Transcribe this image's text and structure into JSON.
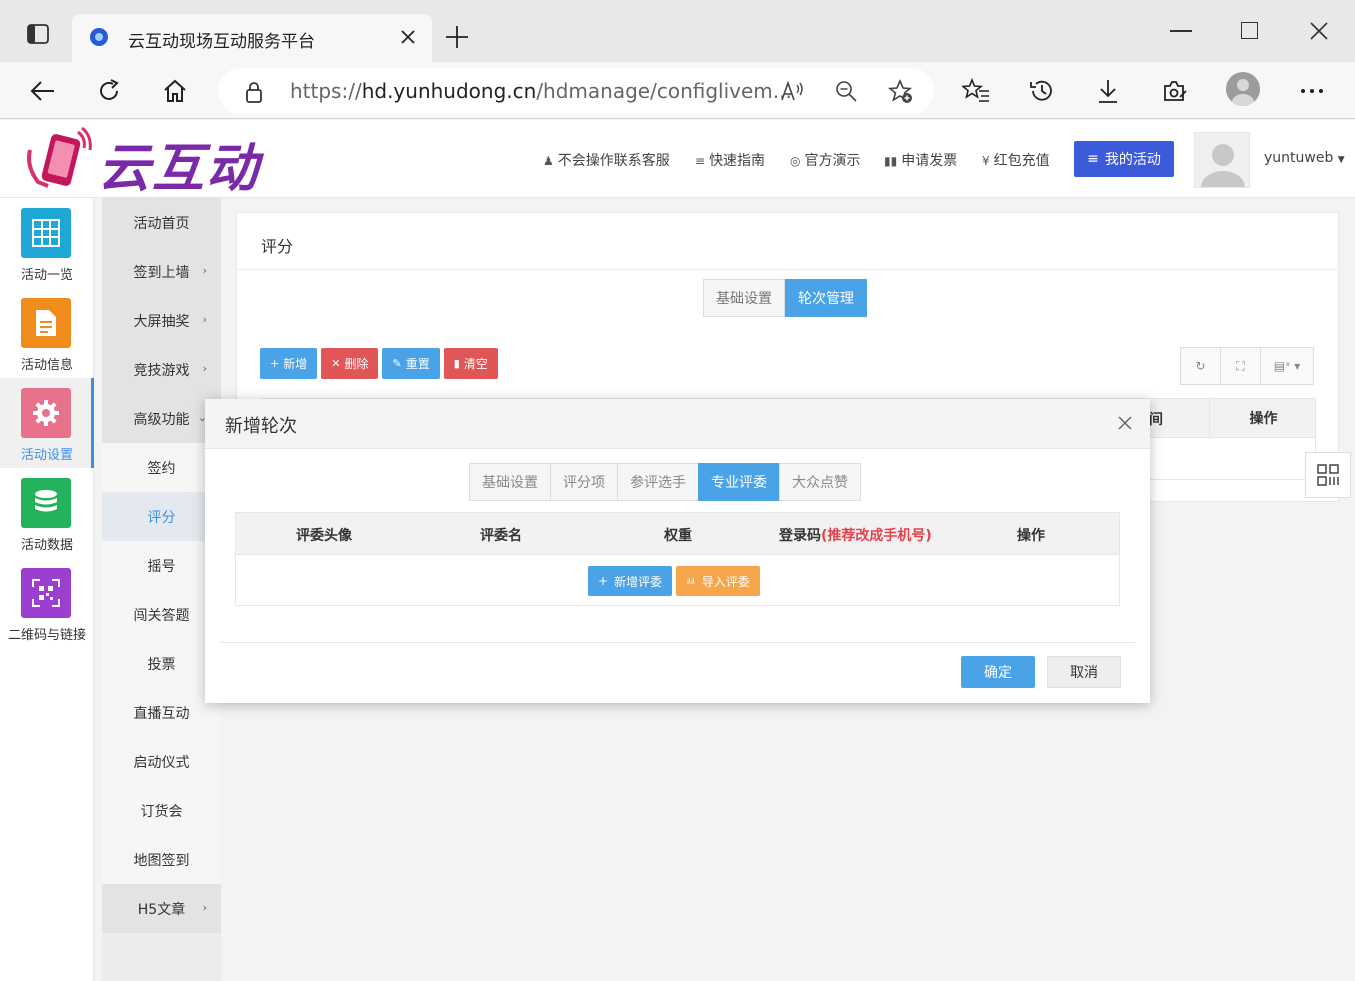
{
  "browser": {
    "tab_title": "云互动现场互动服务平台",
    "url_prefix": "https://",
    "url_domain": "hd.yunhudong.cn",
    "url_path": "/hdmanage/configlivem..."
  },
  "header": {
    "logo_text": "云互动",
    "links": [
      {
        "icon": "person-icon",
        "label": "不会操作联系客服"
      },
      {
        "icon": "list-icon",
        "label": "快速指南"
      },
      {
        "icon": "play-icon",
        "label": "官方演示"
      },
      {
        "icon": "ticket-icon",
        "label": "申请发票"
      },
      {
        "icon": "yen-icon",
        "label": "红包充值"
      }
    ],
    "my_activity": "我的活动",
    "username": "yuntuweb"
  },
  "iconbar": {
    "items": [
      {
        "label": "活动一览",
        "color": "#1fa8d6"
      },
      {
        "label": "活动信息",
        "color": "#f08c1b"
      },
      {
        "label": "活动设置",
        "color": "#e8728c"
      },
      {
        "label": "活动数据",
        "color": "#24b35c"
      },
      {
        "label": "二维码与链接",
        "color": "#9c3fd0"
      }
    ]
  },
  "submenu": {
    "items": [
      {
        "label": "活动首页"
      },
      {
        "label": "签到上墙"
      },
      {
        "label": "大屏抽奖"
      },
      {
        "label": "竞技游戏"
      },
      {
        "label": "高级功能"
      },
      {
        "label": "签约"
      },
      {
        "label": "评分"
      },
      {
        "label": "摇号"
      },
      {
        "label": "闯关答题"
      },
      {
        "label": "投票"
      },
      {
        "label": "直播互动"
      },
      {
        "label": "启动仪式"
      },
      {
        "label": "订货会"
      },
      {
        "label": "地图签到"
      },
      {
        "label": "H5文章"
      }
    ]
  },
  "main": {
    "panel_title": "评分",
    "tabs": [
      "基础设置",
      "轮次管理"
    ],
    "toolbar": [
      "新增",
      "删除",
      "重置",
      "清空"
    ],
    "table_col_time": "间",
    "table_col_op": "操作"
  },
  "modal": {
    "title": "新增轮次",
    "tabs": [
      "基础设置",
      "评分项",
      "参评选手",
      "专业评委",
      "大众点赞"
    ],
    "columns": [
      "评委头像",
      "评委名",
      "权重",
      "登录码",
      "(推荐改成手机号)",
      "操作"
    ],
    "add_judge": "新增评委",
    "import_judge": "导入评委",
    "confirm": "确定",
    "cancel": "取消"
  },
  "colors": {
    "accent": "#4aa3e6",
    "primary_header": "#3b5bdb",
    "danger": "#e05555",
    "warning": "#f5a54a"
  }
}
